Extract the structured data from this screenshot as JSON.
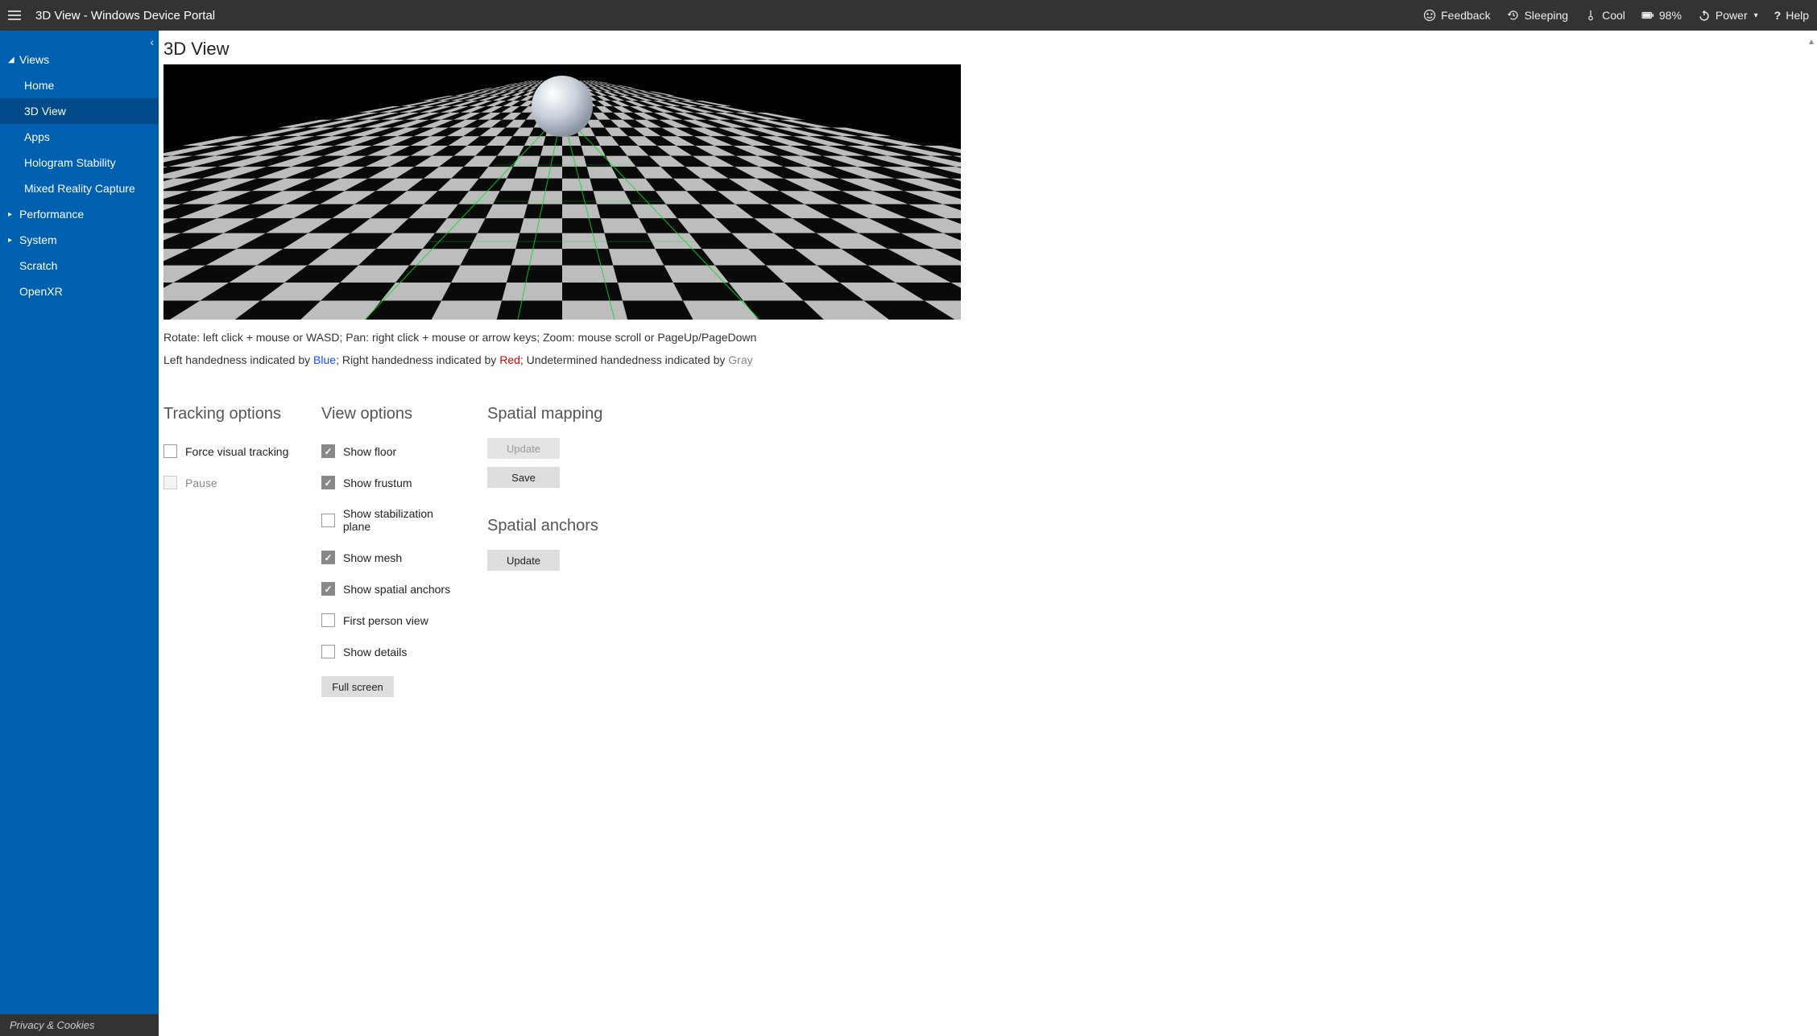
{
  "topbar": {
    "title": "3D View - Windows Device Portal",
    "feedback": "Feedback",
    "sleeping": "Sleeping",
    "cool": "Cool",
    "battery": "98%",
    "power": "Power",
    "help": "Help"
  },
  "sidebar": {
    "views_label": "Views",
    "items": {
      "home": "Home",
      "view3d": "3D View",
      "apps": "Apps",
      "holo": "Hologram Stability",
      "mrc": "Mixed Reality Capture"
    },
    "performance": "Performance",
    "system": "System",
    "scratch": "Scratch",
    "openxr": "OpenXR",
    "privacy": "Privacy & Cookies"
  },
  "main": {
    "page_title": "3D View",
    "help_line": "Rotate: left click + mouse or WASD; Pan: right click + mouse or arrow keys; Zoom: mouse scroll or PageUp/PageDown",
    "hand_prefix_left": "Left handedness indicated by ",
    "hand_blue": "Blue",
    "hand_sep1": "; Right handedness indicated by ",
    "hand_red": "Red",
    "hand_sep2": "; Undetermined handedness indicated by ",
    "hand_gray": "Gray"
  },
  "tracking": {
    "heading": "Tracking options",
    "force": "Force visual tracking",
    "pause": "Pause"
  },
  "view": {
    "heading": "View options",
    "show_floor": "Show floor",
    "show_frustum": "Show frustum",
    "show_stab": "Show stabilization plane",
    "show_mesh": "Show mesh",
    "show_anchors": "Show spatial anchors",
    "fpv": "First person view",
    "details": "Show details",
    "fullscreen": "Full screen"
  },
  "spatial": {
    "mapping_heading": "Spatial mapping",
    "update": "Update",
    "save": "Save",
    "anchors_heading": "Spatial anchors",
    "anchors_update": "Update"
  }
}
